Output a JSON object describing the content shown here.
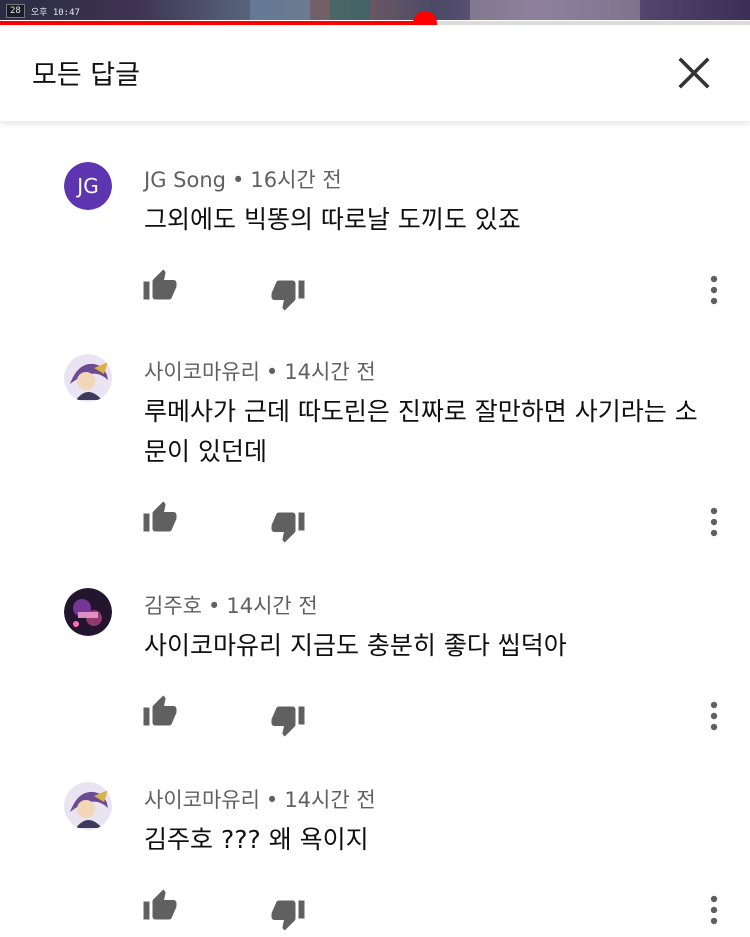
{
  "video": {
    "hud_count": "28",
    "hud_clock": "오후 10:47",
    "progress": 0.567
  },
  "header": {
    "title": "모든 답글",
    "close_icon": "close-icon"
  },
  "comments": [
    {
      "author": "JG Song",
      "time": "16시간 전",
      "text": "그외에도 빅똥의 따로날 도끼도 있죠",
      "avatar_initials": "JG",
      "avatar_color": "#5e35b1"
    },
    {
      "author": "사이코마유리",
      "time": "14시간 전",
      "text": "루메사가 근데 따도린은 진짜로 잘만하면 사기라는 소문이 있던데"
    },
    {
      "author": "김주호",
      "time": "14시간 전",
      "text": "사이코마유리 지금도 충분히 좋다 씹덕아"
    },
    {
      "author": "사이코마유리",
      "time": "14시간 전",
      "text": "김주호 ??? 왜 욕이지"
    }
  ],
  "colors": {
    "accent": "#ff0000",
    "meta_text": "#606060",
    "icon": "#606060"
  }
}
